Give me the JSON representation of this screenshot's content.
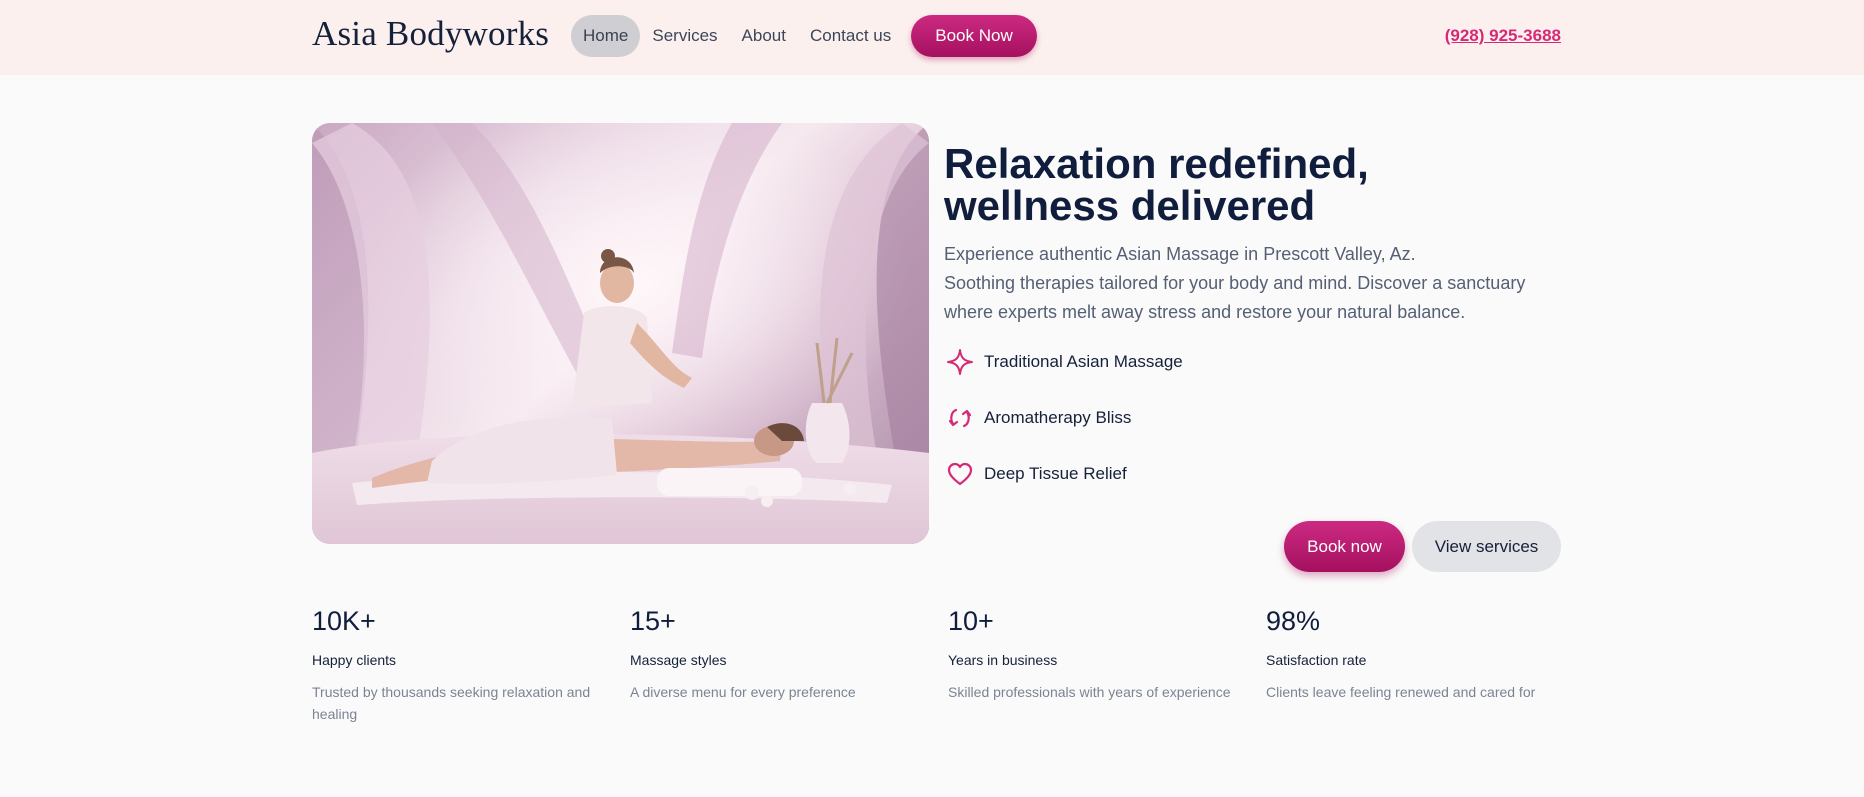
{
  "header": {
    "brand": "Asia Bodyworks",
    "nav": [
      "Home",
      "Services",
      "About",
      "Contact us"
    ],
    "book_label": "Book Now",
    "phone": "(928) 925-3688"
  },
  "hero": {
    "title_lines": [
      "Relaxation redefined,",
      "wellness delivered"
    ],
    "description_lines": [
      "Experience authentic Asian Massage in Prescott Valley, Az.",
      "Soothing therapies tailored for your body and mind. Discover a sanctuary",
      "where experts melt away stress and restore your natural balance."
    ],
    "features": [
      {
        "label": "Traditional Asian Massage",
        "icon": "sparkle-icon"
      },
      {
        "label": "Aromatherapy Bliss",
        "icon": "refresh-icon"
      },
      {
        "label": "Deep Tissue Relief",
        "icon": "heart-icon"
      }
    ],
    "primary_button": "Book now",
    "secondary_button": "View services"
  },
  "stats": [
    {
      "value": "10K+",
      "label": "Happy clients",
      "desc_lines": [
        "Trusted by thousands seeking relaxation and",
        "healing"
      ]
    },
    {
      "value": "15+",
      "label": "Massage styles",
      "desc_lines": [
        "A diverse menu for every preference"
      ]
    },
    {
      "value": "10+",
      "label": "Years in business",
      "desc_lines": [
        "Skilled professionals with years of experience"
      ]
    },
    {
      "value": "98%",
      "label": "Satisfaction rate",
      "desc_lines": [
        "Clients leave feeling renewed and cared for"
      ]
    }
  ],
  "colors": {
    "accent": "#c0186f",
    "header_bg": "#fcf0ee",
    "text_dark": "#101d3d"
  }
}
